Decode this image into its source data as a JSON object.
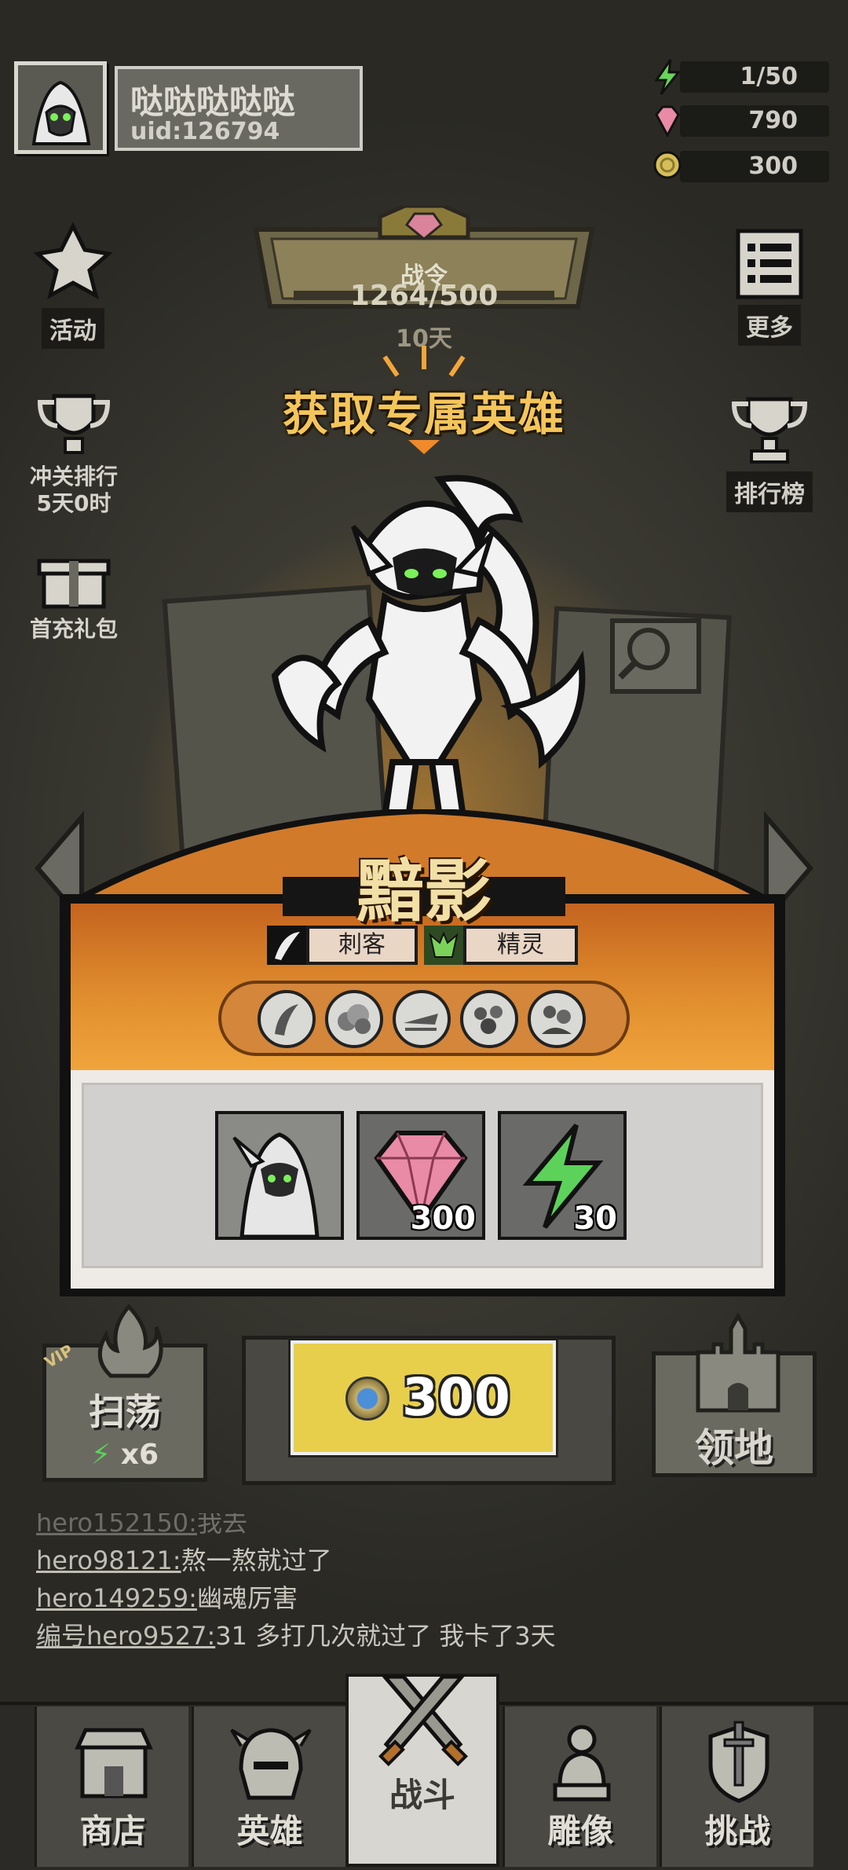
{
  "profile": {
    "name": "哒哒哒哒哒",
    "uid": "uid:126794"
  },
  "resources": {
    "energy": "1/50",
    "gems": "790",
    "coins": "300"
  },
  "left_menu": {
    "activity": "活动",
    "rank_line1": "冲关排行",
    "rank_line2": "5天0时",
    "first_pack": "首充礼包"
  },
  "right_menu": {
    "more": "更多",
    "leaderboard": "排行榜"
  },
  "battle_pass": {
    "title": "战令",
    "progress": "1264/500",
    "days": "10天"
  },
  "promo": {
    "title": "获取专属英雄"
  },
  "hero": {
    "name": "黯影",
    "class": "刺客",
    "race": "精灵",
    "skills": [
      "skill-1",
      "skill-2",
      "skill-3",
      "skill-4",
      "skill-5"
    ]
  },
  "rewards": [
    {
      "type": "hero-portrait",
      "amount": ""
    },
    {
      "type": "gem",
      "amount": "300"
    },
    {
      "type": "energy",
      "amount": "30"
    }
  ],
  "actions": {
    "vip": "VIP",
    "sweep": "扫荡",
    "sweep_count": "x6",
    "cost": "300",
    "territory": "领地"
  },
  "chat": [
    {
      "user": "hero152150:",
      "msg": "我去"
    },
    {
      "user": "hero98121:",
      "msg": "熬一熬就过了"
    },
    {
      "user": "hero149259:",
      "msg": "幽魂厉害"
    },
    {
      "user": "编号hero9527:",
      "msg": "31 多打几次就过了 我卡了3天"
    }
  ],
  "nav": {
    "shop": "商店",
    "hero": "英雄",
    "battle": "战斗",
    "statue": "雕像",
    "challenge": "挑战"
  },
  "colors": {
    "accent": "#f4c55b",
    "orange": "#e2902f",
    "button_yellow": "#e7cf4c"
  }
}
